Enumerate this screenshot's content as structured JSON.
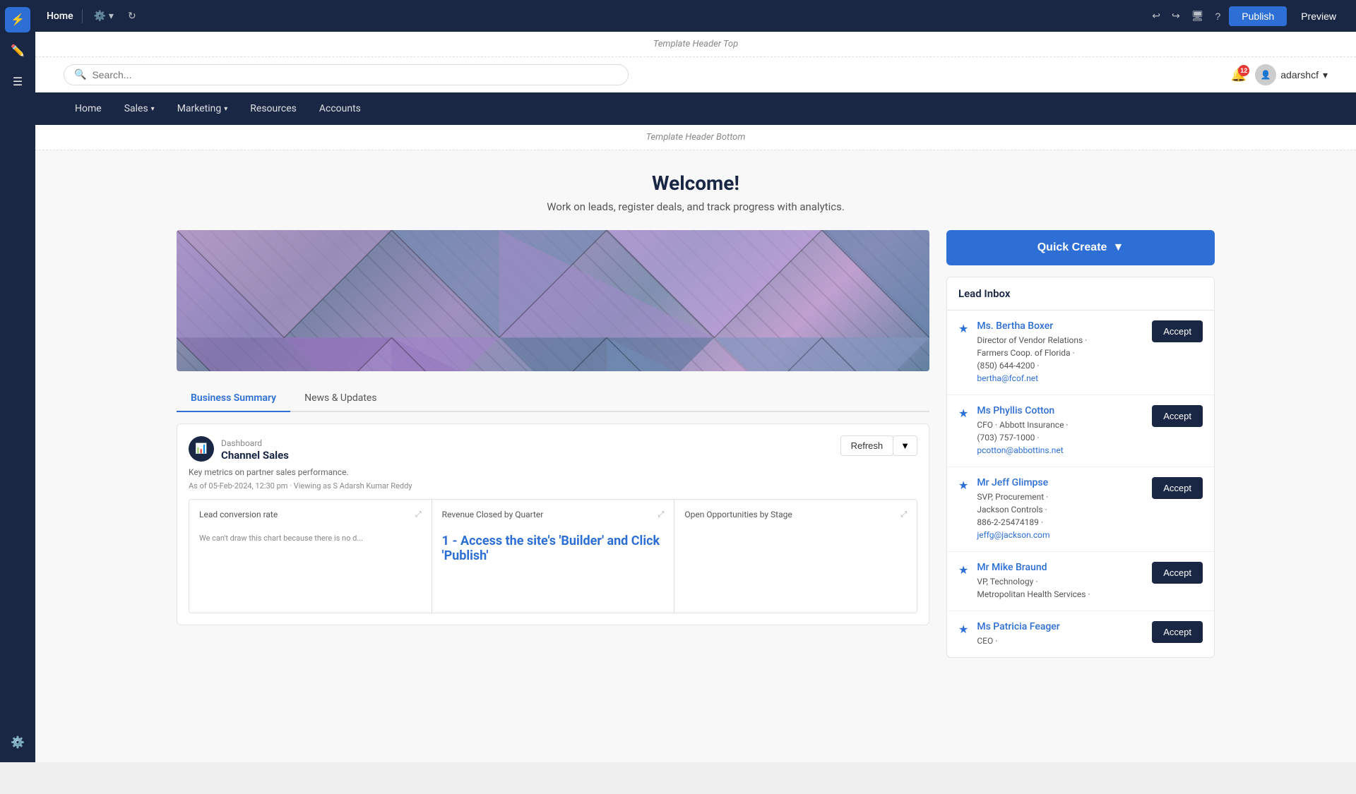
{
  "editor_bar": {
    "page_name": "Home",
    "undo_label": "Undo",
    "redo_label": "Redo",
    "settings_label": "Settings",
    "publish_label": "Publish",
    "preview_label": "Preview"
  },
  "sidebar": {
    "lightning_label": "Lightning",
    "edit_label": "Edit",
    "nav_label": "Navigation",
    "settings_label": "Settings"
  },
  "template": {
    "header_top": "Template Header Top",
    "header_bottom": "Template Header Bottom"
  },
  "search": {
    "placeholder": "Search..."
  },
  "notifications": {
    "count": "12"
  },
  "user": {
    "name": "adarshcf"
  },
  "nav": {
    "items": [
      {
        "label": "Home",
        "has_dropdown": false
      },
      {
        "label": "Sales",
        "has_dropdown": true
      },
      {
        "label": "Marketing",
        "has_dropdown": true
      },
      {
        "label": "Resources",
        "has_dropdown": false
      },
      {
        "label": "Accounts",
        "has_dropdown": false
      }
    ]
  },
  "welcome": {
    "title": "Welcome!",
    "subtitle": "Work on leads, register deals, and track progress with analytics."
  },
  "tabs": [
    {
      "label": "Business Summary",
      "active": true
    },
    {
      "label": "News & Updates",
      "active": false
    }
  ],
  "dashboard": {
    "icon": "📊",
    "type_label": "Dashboard",
    "name": "Channel Sales",
    "description": "Key metrics on partner sales performance.",
    "meta": "As of 05-Feb-2024, 12:30 pm · Viewing as S Adarsh Kumar Reddy",
    "refresh_label": "Refresh",
    "metrics": [
      {
        "title": "Lead conversion rate",
        "no_data_msg": "We can't draw this chart because there is no d..."
      },
      {
        "title": "Revenue Closed by Quarter",
        "chart_value": ""
      },
      {
        "title": "Open Opportunities by Stage",
        "chart_value": ""
      }
    ]
  },
  "quick_create": {
    "label": "Quick Create",
    "dropdown_icon": "▼"
  },
  "lead_inbox": {
    "title": "Lead Inbox",
    "accept_label": "Accept",
    "leads": [
      {
        "name": "Ms. Bertha Boxer",
        "title": "Director of Vendor Relations",
        "company": "Farmers Coop. of Florida",
        "phone": "(850) 644-4200",
        "email": "bertha@fcof.net"
      },
      {
        "name": "Ms Phyllis Cotton",
        "title": "CFO",
        "company": "Abbott Insurance",
        "phone": "(703) 757-1000",
        "email": "pcotton@abbottins.net"
      },
      {
        "name": "Mr Jeff Glimpse",
        "title": "SVP, Procurement",
        "company": "Jackson Controls",
        "phone": "886-2-25474189",
        "email": "jeffg@jackson.com"
      },
      {
        "name": "Mr Mike Braund",
        "title": "VP, Technology",
        "company": "Metropolitan Health Services",
        "phone": "",
        "email": ""
      },
      {
        "name": "Ms Patricia Feager",
        "title": "CEO",
        "company": "",
        "phone": "",
        "email": ""
      }
    ]
  },
  "publish_hint": "1 - Access the site's 'Builder' and Click 'Publish'"
}
